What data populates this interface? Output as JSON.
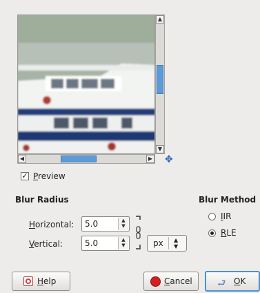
{
  "preview": {
    "image_alt": "white ferry boat with blue stripe on water (blurred preview)",
    "checkbox_label": "Preview",
    "checked": true
  },
  "scrollbars": {
    "up_icon": "scroll-up-arrow",
    "down_icon": "scroll-down-arrow",
    "left_icon": "scroll-left-arrow",
    "right_icon": "scroll-right-arrow",
    "navigate_icon": "navigate-cross-arrows"
  },
  "blur_radius": {
    "heading": "Blur Radius",
    "horizontal_label": "Horizontal:",
    "horizontal_value": "5.0",
    "vertical_label": "Vertical:",
    "vertical_value": "5.0",
    "unit": "px"
  },
  "blur_method": {
    "heading": "Blur Method",
    "options": [
      {
        "label": "IIR",
        "selected": false
      },
      {
        "label": "RLE",
        "selected": true
      }
    ]
  },
  "buttons": {
    "help": "Help",
    "cancel": "Cancel",
    "ok": "OK"
  },
  "colors": {
    "accent": "#4a90d9",
    "scroll_thumb": "#5d9bd6",
    "cancel_icon": "#d42020"
  }
}
